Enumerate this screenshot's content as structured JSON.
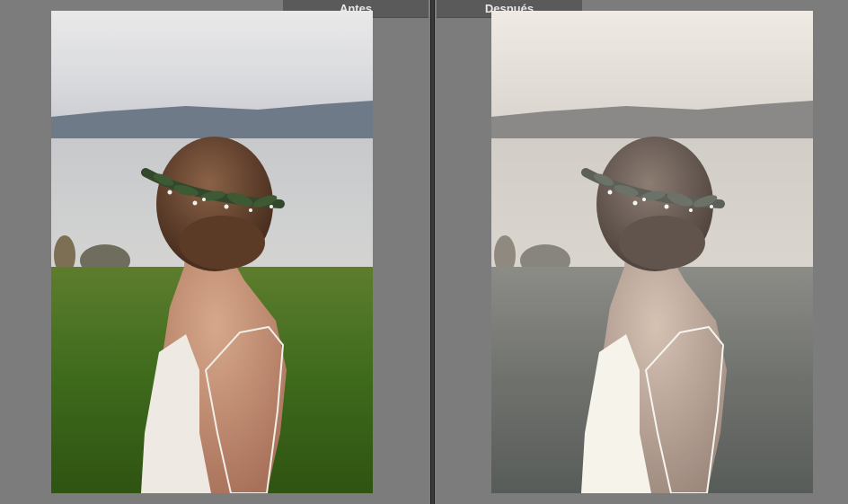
{
  "labels": {
    "before": "Antes",
    "after": "Después"
  },
  "colors": {
    "background": "#7b7b7b",
    "tab": "#5a5a5a",
    "divider": "#3a3a3a",
    "label_text": "#e8e8e8"
  },
  "photos": {
    "before_style": "original-saturated",
    "after_style": "desaturated-muted"
  }
}
